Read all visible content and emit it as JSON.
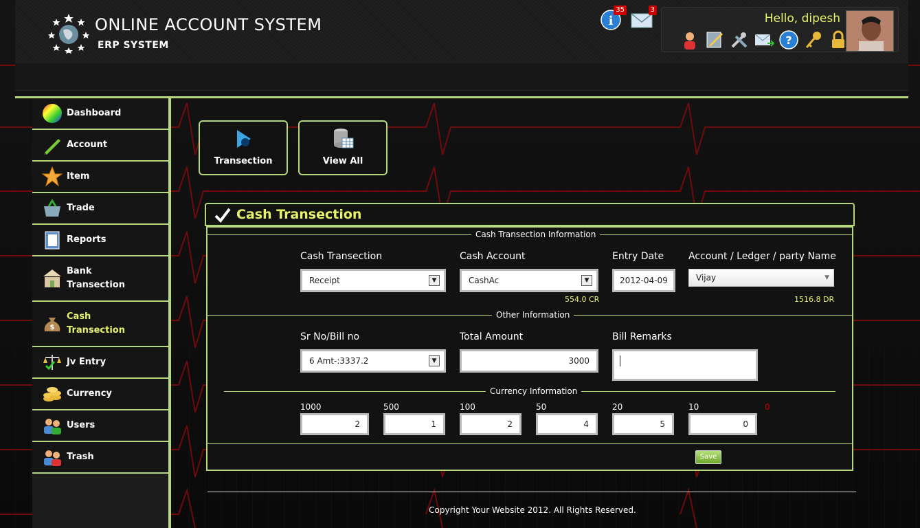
{
  "header": {
    "title": "ONLINE ACCOUNT SYSTEM",
    "subtitle": "ERP SYSTEM",
    "info_count": "35",
    "mail_count": "3",
    "greeting": "Hello, dipesh"
  },
  "sidebar": {
    "items": [
      {
        "label": "Dashboard",
        "icon": "color-wheel-icon"
      },
      {
        "label": "Account",
        "icon": "pencil-icon"
      },
      {
        "label": "Item",
        "icon": "star-icon"
      },
      {
        "label": "Trade",
        "icon": "basket-icon"
      },
      {
        "label": "Reports",
        "icon": "notebook-icon"
      },
      {
        "label": "Bank Transection",
        "icon": "bank-icon"
      },
      {
        "label": "Cash Transection",
        "icon": "money-bag-icon",
        "active": true
      },
      {
        "label": "Jv Entry",
        "icon": "scales-icon"
      },
      {
        "label": "Currency",
        "icon": "coins-icon"
      },
      {
        "label": "Users",
        "icon": "users-icon"
      },
      {
        "label": "Trash",
        "icon": "trash-users-icon"
      }
    ]
  },
  "quick": {
    "transection_label": "Transection",
    "view_all_label": "View All"
  },
  "panel": {
    "title": "Cash Transection",
    "section1": "Cash Transection Information",
    "section2": "Other Information",
    "section3": "Currency Information",
    "cash_transection_label": "Cash Transection",
    "cash_transection_value": "Receipt",
    "cash_account_label": "Cash Account",
    "cash_account_value": "CashAc",
    "cash_account_balance": "554.0 CR",
    "entry_date_label": "Entry Date",
    "entry_date_value": "2012-04-09",
    "party_label": "Account / Ledger / party Name",
    "party_value": "Vijay",
    "party_balance": "1516.8 DR",
    "bill_no_label": "Sr No/Bill no",
    "bill_no_value": "6 Amt-:3337.2",
    "total_amount_label": "Total Amount",
    "total_amount_value": "3000",
    "bill_remarks_label": "Bill Remarks",
    "bill_remarks_value": "",
    "currency": [
      {
        "denom": "1000",
        "count": "2"
      },
      {
        "denom": "500",
        "count": "1"
      },
      {
        "denom": "100",
        "count": "2"
      },
      {
        "denom": "50",
        "count": "4"
      },
      {
        "denom": "20",
        "count": "5"
      },
      {
        "denom": "10",
        "count": "0"
      }
    ],
    "currency_diff": "0",
    "save_label": "Save"
  },
  "footer": {
    "text": "Copyright Your Website 2012. All Rights Reserved."
  },
  "colors": {
    "accent": "#b6d77b",
    "highlight": "#e7f36b",
    "alert": "#cc0000"
  }
}
